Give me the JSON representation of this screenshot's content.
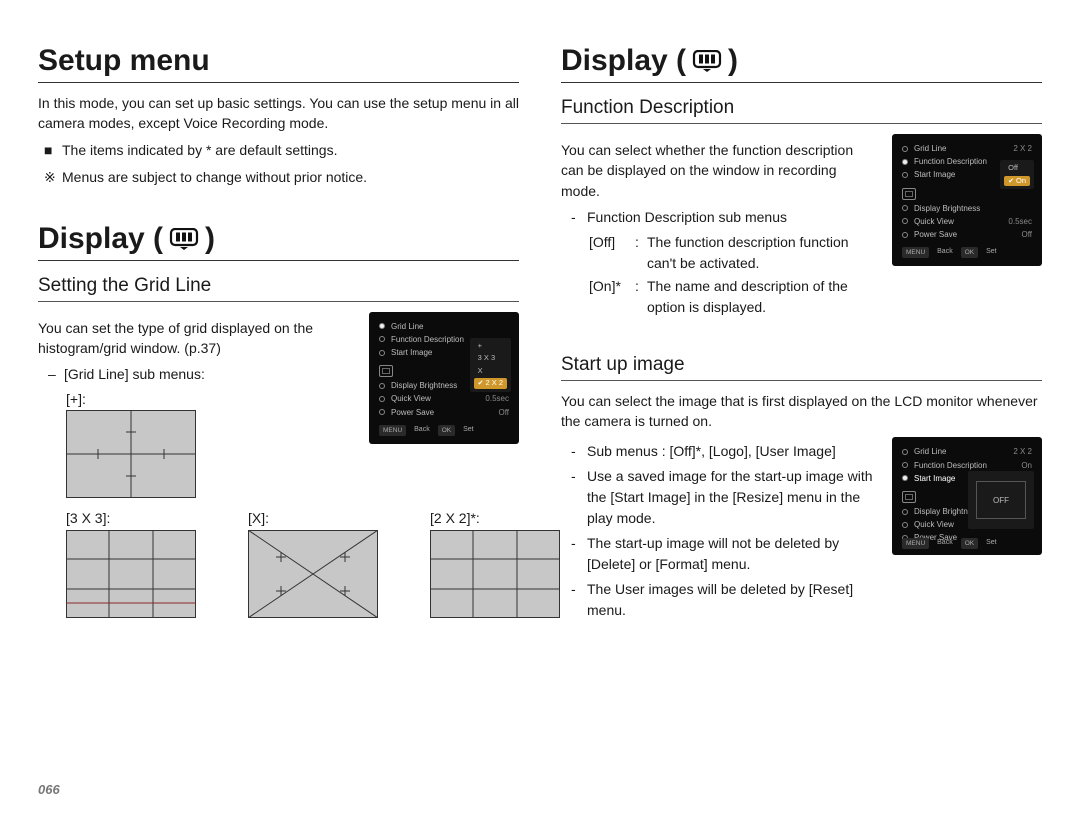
{
  "page_number": "066",
  "left": {
    "h1a": "Setup menu",
    "intro": "In this mode, you can set up basic settings. You can use the setup menu in all camera modes, except Voice Recording mode.",
    "note1_mark": "■",
    "note1": "The items indicated by * are default settings.",
    "note2_mark": "※",
    "note2": "Menus are subject to change without prior notice.",
    "h1b": "Display (",
    "h1b_close": " )",
    "h2a": "Setting the Grid Line",
    "grid_intro": "You can set the type of grid displayed on the histogram/grid window. (p.37)",
    "grid_sub_label": "[Grid Line] sub menus:",
    "grid_plus": "[+]:",
    "grid_3x3": "[3 X 3]:",
    "grid_x": "[X]:",
    "grid_2x2": "[2 X 2]*:",
    "shot1": {
      "rows": [
        {
          "label": "Grid Line",
          "val": ""
        },
        {
          "label": "Function Description",
          "val": ""
        },
        {
          "label": "Start Image",
          "val": ""
        },
        {
          "label": "Display  Brightness",
          "val": ""
        },
        {
          "label": "Quick View",
          "val": "0.5sec"
        },
        {
          "label": "Power Save",
          "val": "Off"
        }
      ],
      "opts": [
        "+",
        "3 X 3",
        "X",
        "2 X 2"
      ],
      "sel": 3,
      "foot": {
        "back_btn": "MENU",
        "back": "Back",
        "ok_btn": "OK",
        "set": "Set"
      }
    }
  },
  "right": {
    "h1": "Display (",
    "h1_close": " )",
    "h2a": "Function Description",
    "fd_intro": "You can select whether the function description can be displayed on the window in recording mode.",
    "fd_sub": "Function Description sub menus",
    "fd_off_k": "[Off]",
    "fd_off_v": "The function description function can't be activated.",
    "fd_on_k": "[On]*",
    "fd_on_v": "The name and description of the option is displayed.",
    "shot2": {
      "rows": [
        {
          "label": "Grid Line",
          "val": "2 X 2"
        },
        {
          "label": "Function Description",
          "val": ""
        },
        {
          "label": "Start Image",
          "val": ""
        },
        {
          "label": "Display  Brightness",
          "val": ""
        },
        {
          "label": "Quick View",
          "val": "0.5sec"
        },
        {
          "label": "Power Save",
          "val": "Off"
        }
      ],
      "opts": [
        "Off",
        "On"
      ],
      "sel": 1,
      "foot": {
        "back_btn": "MENU",
        "back": "Back",
        "ok_btn": "OK",
        "set": "Set"
      }
    },
    "h2b": "Start up image",
    "su_intro": "You can select the image that is first displayed on the LCD monitor whenever the camera is turned on.",
    "su_b1": "Sub menus : [Off]*, [Logo], [User Image]",
    "su_b2": "Use a saved image for the start-up image with the [Start Image] in the [Resize] menu in the play mode.",
    "su_b3": "The start-up image will not be deleted by [Delete] or [Format] menu.",
    "su_b4": "The User images will be deleted by [Reset] menu.",
    "shot3": {
      "rows": [
        {
          "label": "Grid Line",
          "val": "2 X 2"
        },
        {
          "label": "Function Description",
          "val": "On"
        },
        {
          "label": "Start Image",
          "val": ""
        },
        {
          "label": "Display  Brightness",
          "val": ""
        },
        {
          "label": "Quick View",
          "val": ""
        },
        {
          "label": "Power Save",
          "val": ""
        }
      ],
      "preview": "OFF",
      "foot": {
        "back_btn": "MENU",
        "back": "Back",
        "ok_btn": "OK",
        "set": "Set"
      }
    }
  }
}
